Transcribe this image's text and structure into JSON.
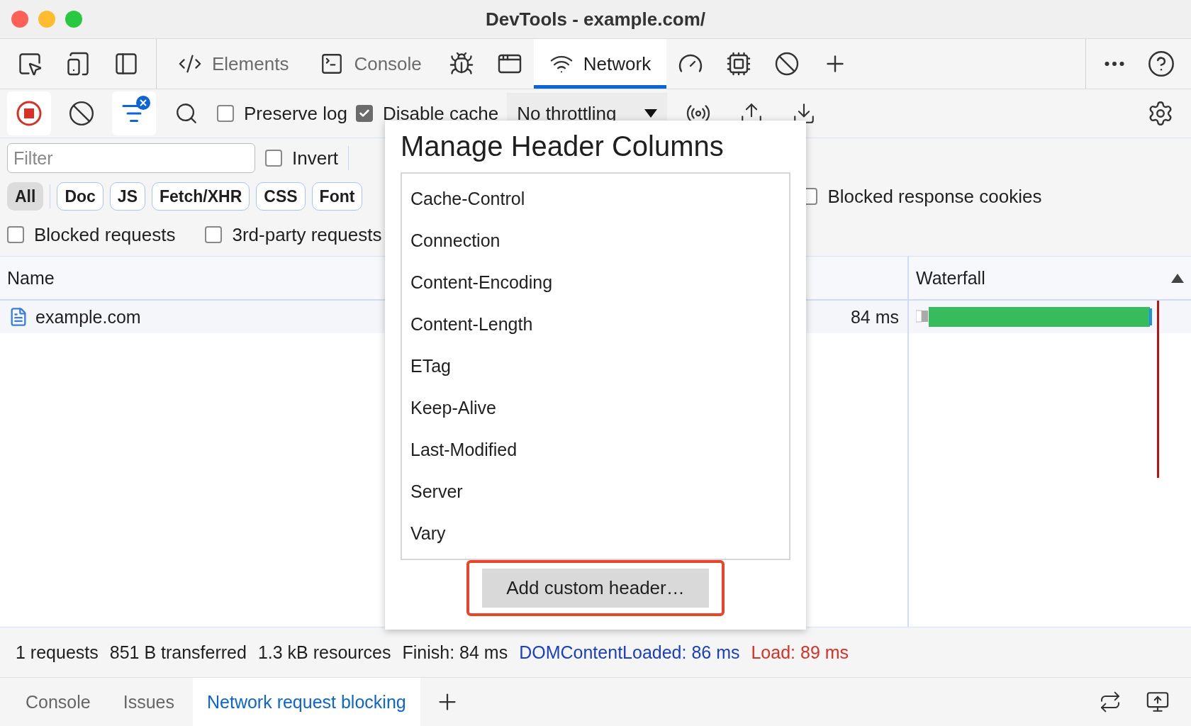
{
  "window": {
    "title": "DevTools - example.com/"
  },
  "panel_tabs": [
    {
      "kind": "icon",
      "selected": false
    },
    {
      "kind": "icon",
      "selected": false
    },
    {
      "kind": "icon",
      "selected": false
    },
    {
      "kind": "text",
      "label": "Elements",
      "selected": false
    },
    {
      "kind": "text",
      "label": "Console",
      "selected": false
    },
    {
      "kind": "icon",
      "selected": false
    },
    {
      "kind": "icon",
      "selected": false
    },
    {
      "kind": "text",
      "label": "Network",
      "selected": true
    },
    {
      "kind": "icon",
      "selected": false
    },
    {
      "kind": "icon",
      "selected": false
    },
    {
      "kind": "icon",
      "selected": false
    },
    {
      "kind": "icon",
      "selected": false
    }
  ],
  "toolbar": {
    "recording": true,
    "filter_active": true,
    "preserve_log": {
      "label": "Preserve log",
      "checked": false
    },
    "disable_cache": {
      "label": "Disable cache",
      "checked": true
    },
    "throttling": "No throttling"
  },
  "filters": {
    "placeholder": "Filter",
    "invert": {
      "label": "Invert",
      "checked": false
    },
    "types": [
      {
        "label": "All",
        "selected": true
      },
      {
        "label": "Doc",
        "selected": false
      },
      {
        "label": "JS",
        "selected": false
      },
      {
        "label": "Fetch/XHR",
        "selected": false
      },
      {
        "label": "CSS",
        "selected": false
      },
      {
        "label": "Font",
        "selected": false
      }
    ],
    "blocked_response_cookies": {
      "label": "Blocked response cookies",
      "checked": false
    },
    "blocked_requests": {
      "label": "Blocked requests",
      "checked": false
    },
    "third_party": {
      "label": "3rd-party requests",
      "checked": false
    }
  },
  "table": {
    "name_header": "Name",
    "waterfall_header": "Waterfall",
    "rows": [
      {
        "name": "example.com",
        "time": "84 ms"
      }
    ]
  },
  "dialog": {
    "title": "Manage Header Columns",
    "headers": [
      "Cache-Control",
      "Connection",
      "Content-Encoding",
      "Content-Length",
      "ETag",
      "Keep-Alive",
      "Last-Modified",
      "Server",
      "Vary"
    ],
    "button": "Add custom header…",
    "highlighted": true
  },
  "status_bar": [
    {
      "text": "1 requests",
      "color": "#1f1f1f"
    },
    {
      "text": "851 B transferred",
      "color": "#1f1f1f"
    },
    {
      "text": "1.3 kB resources",
      "color": "#1f1f1f"
    },
    {
      "text": "Finish: 84 ms",
      "color": "#1f1f1f"
    },
    {
      "text": "DOMContentLoaded: 86 ms",
      "color": "#1a3fc4"
    },
    {
      "text": "Load: 89 ms",
      "color": "#d93025"
    }
  ],
  "drawer_tabs": [
    {
      "label": "Console",
      "selected": false
    },
    {
      "label": "Issues",
      "selected": false
    },
    {
      "label": "Network request blocking",
      "selected": true
    }
  ]
}
